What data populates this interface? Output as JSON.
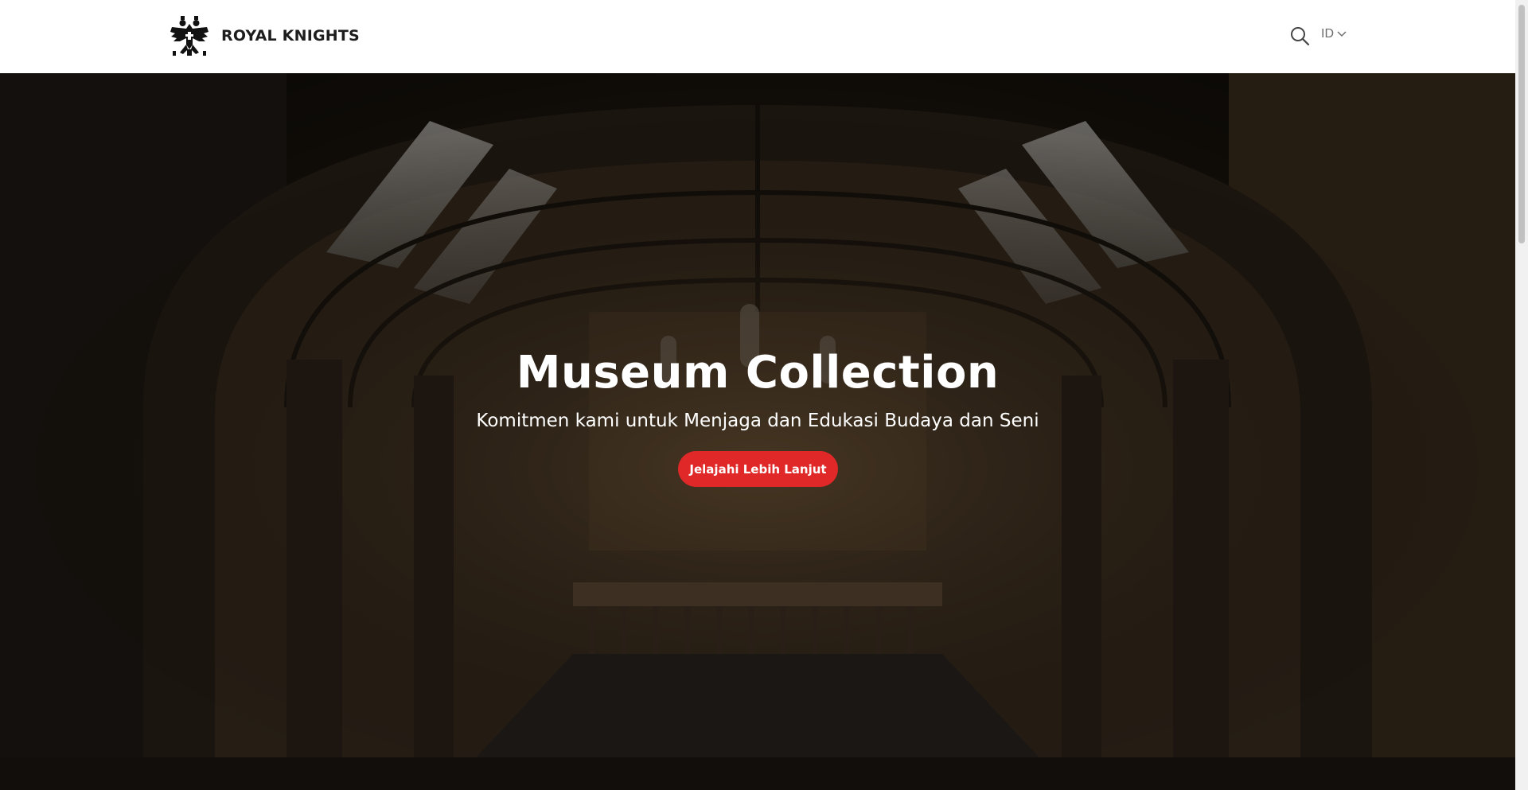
{
  "header": {
    "brand_name": "ROYAL KNIGHTS",
    "language": "ID",
    "icons": {
      "logo": "double-headed-eagle-crest",
      "search": "search-icon",
      "chevron": "chevron-down-icon"
    }
  },
  "hero": {
    "title": "Museum Collection",
    "subtitle": "Komitmen kami untuk Menjaga dan Edukasi Budaya dan Seni",
    "cta_label": "Jelajahi Lebih Lanjut",
    "image": "museum-great-hall-arched-ceiling"
  },
  "colors": {
    "cta": "#e02828",
    "header_bg": "#ffffff",
    "brand_text": "#1d1d1d"
  }
}
